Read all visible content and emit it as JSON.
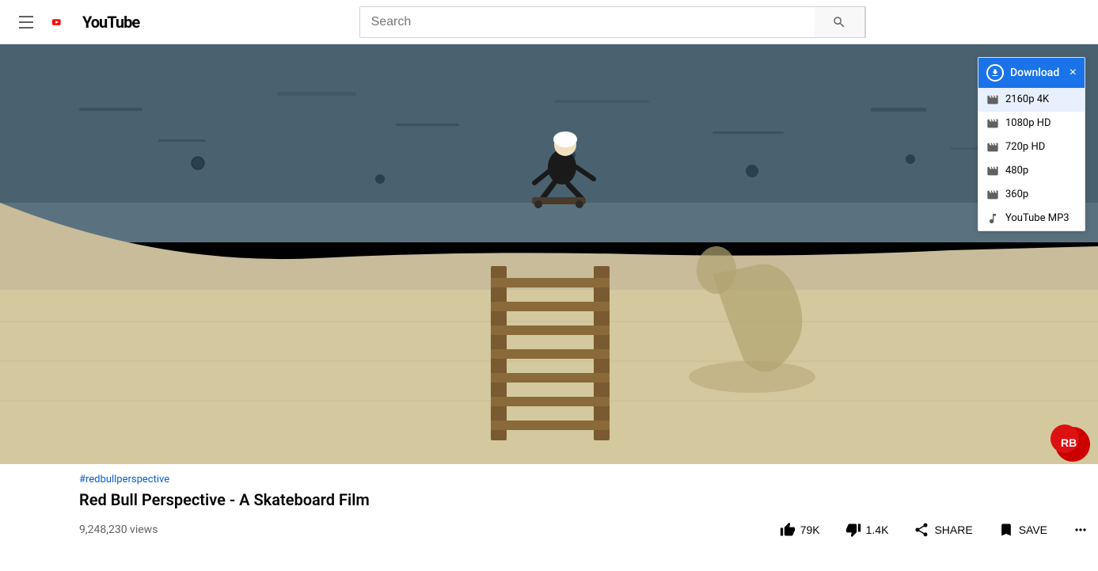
{
  "header": {
    "search_placeholder": "Search",
    "youtube_label": "YouTube"
  },
  "video": {
    "hashtag": "#redbullperspective",
    "title": "Red Bull Perspective - A Skateboard Film",
    "views": "9,248,230 views"
  },
  "actions": {
    "like_label": "79K",
    "dislike_label": "1.4K",
    "share_label": "SHARE",
    "save_label": "SAVE"
  },
  "download_dropdown": {
    "header_label": "Download",
    "close_label": "×",
    "options": [
      {
        "label": "2160p 4K",
        "type": "video",
        "selected": true
      },
      {
        "label": "1080p HD",
        "type": "video",
        "selected": false
      },
      {
        "label": "720p HD",
        "type": "video",
        "selected": false
      },
      {
        "label": "480p",
        "type": "video",
        "selected": false
      },
      {
        "label": "360p",
        "type": "video",
        "selected": false
      },
      {
        "label": "YouTube MP3",
        "type": "music",
        "selected": false
      }
    ]
  }
}
